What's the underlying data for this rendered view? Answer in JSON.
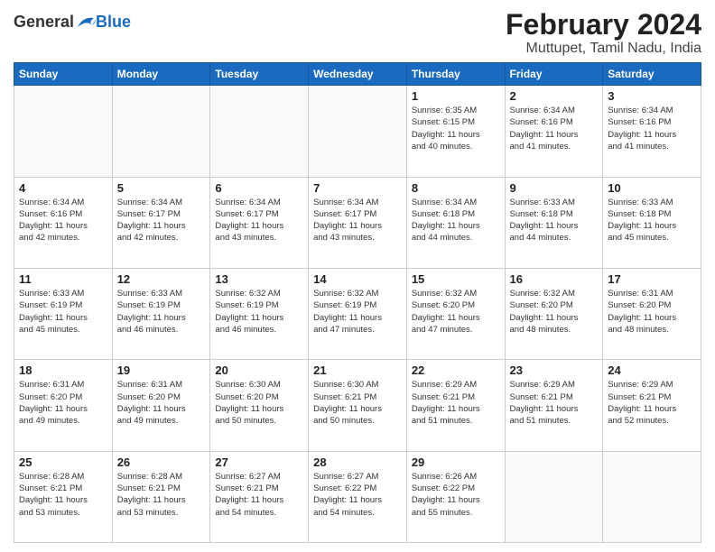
{
  "logo": {
    "general": "General",
    "blue": "Blue"
  },
  "title": "February 2024",
  "location": "Muttupet, Tamil Nadu, India",
  "days_of_week": [
    "Sunday",
    "Monday",
    "Tuesday",
    "Wednesday",
    "Thursday",
    "Friday",
    "Saturday"
  ],
  "weeks": [
    [
      {
        "day": "",
        "info": ""
      },
      {
        "day": "",
        "info": ""
      },
      {
        "day": "",
        "info": ""
      },
      {
        "day": "",
        "info": ""
      },
      {
        "day": "1",
        "info": "Sunrise: 6:35 AM\nSunset: 6:15 PM\nDaylight: 11 hours\nand 40 minutes."
      },
      {
        "day": "2",
        "info": "Sunrise: 6:34 AM\nSunset: 6:16 PM\nDaylight: 11 hours\nand 41 minutes."
      },
      {
        "day": "3",
        "info": "Sunrise: 6:34 AM\nSunset: 6:16 PM\nDaylight: 11 hours\nand 41 minutes."
      }
    ],
    [
      {
        "day": "4",
        "info": "Sunrise: 6:34 AM\nSunset: 6:16 PM\nDaylight: 11 hours\nand 42 minutes."
      },
      {
        "day": "5",
        "info": "Sunrise: 6:34 AM\nSunset: 6:17 PM\nDaylight: 11 hours\nand 42 minutes."
      },
      {
        "day": "6",
        "info": "Sunrise: 6:34 AM\nSunset: 6:17 PM\nDaylight: 11 hours\nand 43 minutes."
      },
      {
        "day": "7",
        "info": "Sunrise: 6:34 AM\nSunset: 6:17 PM\nDaylight: 11 hours\nand 43 minutes."
      },
      {
        "day": "8",
        "info": "Sunrise: 6:34 AM\nSunset: 6:18 PM\nDaylight: 11 hours\nand 44 minutes."
      },
      {
        "day": "9",
        "info": "Sunrise: 6:33 AM\nSunset: 6:18 PM\nDaylight: 11 hours\nand 44 minutes."
      },
      {
        "day": "10",
        "info": "Sunrise: 6:33 AM\nSunset: 6:18 PM\nDaylight: 11 hours\nand 45 minutes."
      }
    ],
    [
      {
        "day": "11",
        "info": "Sunrise: 6:33 AM\nSunset: 6:19 PM\nDaylight: 11 hours\nand 45 minutes."
      },
      {
        "day": "12",
        "info": "Sunrise: 6:33 AM\nSunset: 6:19 PM\nDaylight: 11 hours\nand 46 minutes."
      },
      {
        "day": "13",
        "info": "Sunrise: 6:32 AM\nSunset: 6:19 PM\nDaylight: 11 hours\nand 46 minutes."
      },
      {
        "day": "14",
        "info": "Sunrise: 6:32 AM\nSunset: 6:19 PM\nDaylight: 11 hours\nand 47 minutes."
      },
      {
        "day": "15",
        "info": "Sunrise: 6:32 AM\nSunset: 6:20 PM\nDaylight: 11 hours\nand 47 minutes."
      },
      {
        "day": "16",
        "info": "Sunrise: 6:32 AM\nSunset: 6:20 PM\nDaylight: 11 hours\nand 48 minutes."
      },
      {
        "day": "17",
        "info": "Sunrise: 6:31 AM\nSunset: 6:20 PM\nDaylight: 11 hours\nand 48 minutes."
      }
    ],
    [
      {
        "day": "18",
        "info": "Sunrise: 6:31 AM\nSunset: 6:20 PM\nDaylight: 11 hours\nand 49 minutes."
      },
      {
        "day": "19",
        "info": "Sunrise: 6:31 AM\nSunset: 6:20 PM\nDaylight: 11 hours\nand 49 minutes."
      },
      {
        "day": "20",
        "info": "Sunrise: 6:30 AM\nSunset: 6:20 PM\nDaylight: 11 hours\nand 50 minutes."
      },
      {
        "day": "21",
        "info": "Sunrise: 6:30 AM\nSunset: 6:21 PM\nDaylight: 11 hours\nand 50 minutes."
      },
      {
        "day": "22",
        "info": "Sunrise: 6:29 AM\nSunset: 6:21 PM\nDaylight: 11 hours\nand 51 minutes."
      },
      {
        "day": "23",
        "info": "Sunrise: 6:29 AM\nSunset: 6:21 PM\nDaylight: 11 hours\nand 51 minutes."
      },
      {
        "day": "24",
        "info": "Sunrise: 6:29 AM\nSunset: 6:21 PM\nDaylight: 11 hours\nand 52 minutes."
      }
    ],
    [
      {
        "day": "25",
        "info": "Sunrise: 6:28 AM\nSunset: 6:21 PM\nDaylight: 11 hours\nand 53 minutes."
      },
      {
        "day": "26",
        "info": "Sunrise: 6:28 AM\nSunset: 6:21 PM\nDaylight: 11 hours\nand 53 minutes."
      },
      {
        "day": "27",
        "info": "Sunrise: 6:27 AM\nSunset: 6:21 PM\nDaylight: 11 hours\nand 54 minutes."
      },
      {
        "day": "28",
        "info": "Sunrise: 6:27 AM\nSunset: 6:22 PM\nDaylight: 11 hours\nand 54 minutes."
      },
      {
        "day": "29",
        "info": "Sunrise: 6:26 AM\nSunset: 6:22 PM\nDaylight: 11 hours\nand 55 minutes."
      },
      {
        "day": "",
        "info": ""
      },
      {
        "day": "",
        "info": ""
      }
    ]
  ]
}
